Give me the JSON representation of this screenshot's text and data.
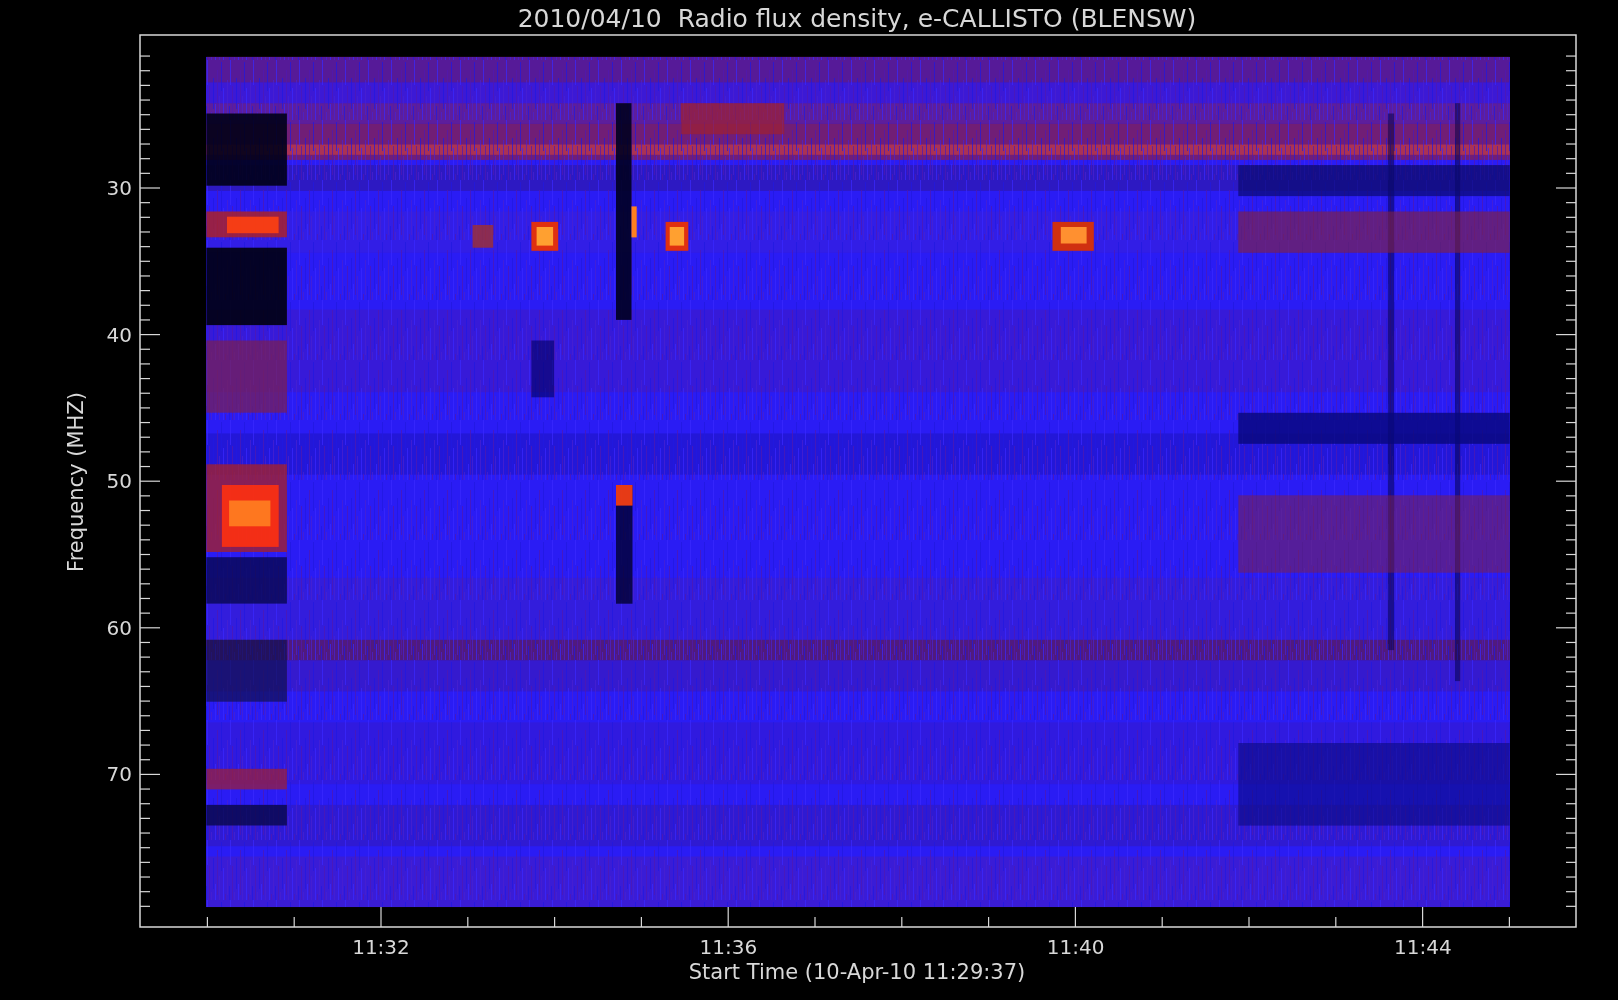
{
  "title": "2010/04/10  Radio flux density, e-CALLISTO (BLENSW)",
  "y_axis": {
    "label": "Frequency (MHZ)",
    "ticks": [
      "30",
      "40",
      "50",
      "60",
      "70"
    ]
  },
  "x_axis": {
    "label": "Start Time (10-Apr-10 11:29:37)",
    "ticks": [
      "11:32",
      "11:36",
      "11:40",
      "11:44"
    ]
  }
}
